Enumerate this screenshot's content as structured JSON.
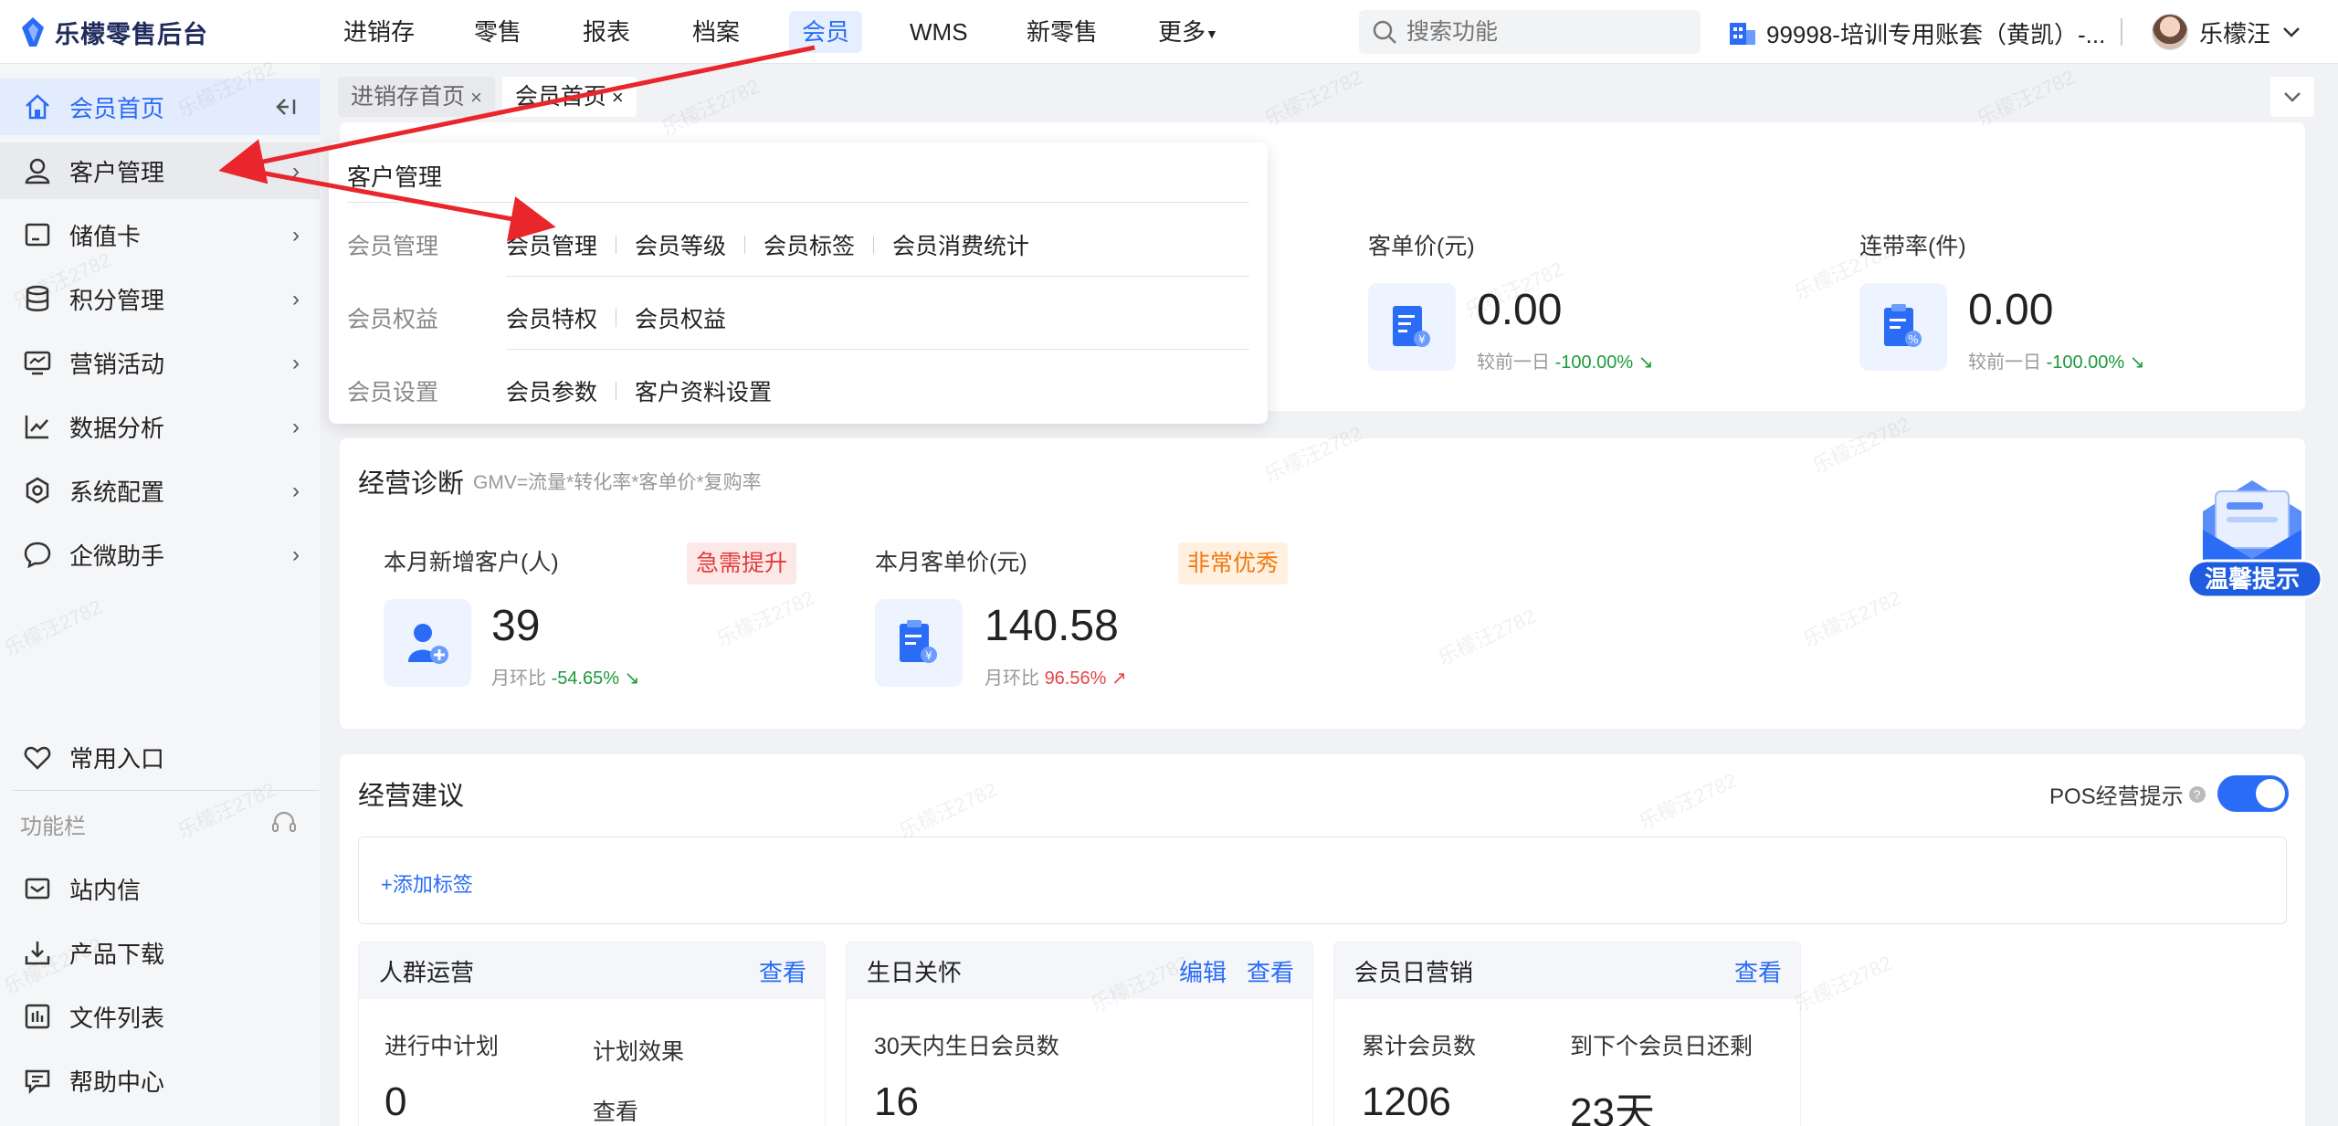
{
  "brand": {
    "name": "乐檬零售后台"
  },
  "nav": {
    "items": [
      {
        "label": "进销存"
      },
      {
        "label": "零售"
      },
      {
        "label": "报表"
      },
      {
        "label": "档案"
      },
      {
        "label": "会员",
        "active": true
      },
      {
        "label": "WMS"
      },
      {
        "label": "新零售"
      },
      {
        "label": "更多"
      }
    ],
    "search_placeholder": "搜索功能",
    "account": "99998-培训专用账套（黄凯）-...",
    "user": "乐檬汪"
  },
  "sidebar": {
    "items": [
      {
        "label": "会员首页",
        "icon": "home-icon",
        "active": true
      },
      {
        "label": "客户管理",
        "icon": "user-icon"
      },
      {
        "label": "储值卡",
        "icon": "card-icon"
      },
      {
        "label": "积分管理",
        "icon": "database-icon"
      },
      {
        "label": "营销活动",
        "icon": "monitor-icon"
      },
      {
        "label": "数据分析",
        "icon": "chart-icon"
      },
      {
        "label": "系统配置",
        "icon": "settings-icon"
      },
      {
        "label": "企微助手",
        "icon": "chat-icon"
      }
    ],
    "favorites": "常用入口",
    "toolbar_label": "功能栏",
    "tools": [
      {
        "label": "站内信",
        "icon": "mail-icon"
      },
      {
        "label": "产品下载",
        "icon": "download-icon"
      },
      {
        "label": "文件列表",
        "icon": "file-list-icon"
      },
      {
        "label": "帮助中心",
        "icon": "help-icon"
      }
    ]
  },
  "tabs": [
    {
      "label": "进销存首页"
    },
    {
      "label": "会员首页",
      "active": true
    }
  ],
  "metrics": [
    {
      "title": "客单价(元)",
      "value": "0.00",
      "cmp_label": "较前一日",
      "cmp_value": "-100.00%"
    },
    {
      "title": "连带率(件)",
      "value": "0.00",
      "cmp_label": "较前一日",
      "cmp_value": "-100.00%"
    }
  ],
  "diagnosis": {
    "title": "经营诊断",
    "formula": "GMV=流量*转化率*客单价*复购率",
    "items": [
      {
        "title": "本月新增客户(人)",
        "tag": "急需提升",
        "value": "39",
        "cmp_label": "月环比",
        "cmp_value": "-54.65%"
      },
      {
        "title": "本月客单价(元)",
        "tag": "非常优秀",
        "value": "140.58",
        "cmp_label": "月环比",
        "cmp_value": "96.56%"
      }
    ]
  },
  "advice": {
    "title": "经营建议",
    "pos_label": "POS经营提示",
    "pos_enabled": true,
    "add_tag": "+添加标签",
    "cards": [
      {
        "title": "人群运营",
        "actions": [
          "查看"
        ],
        "labels": [
          "进行中计划",
          "计划效果"
        ],
        "values": [
          "0",
          "查看"
        ]
      },
      {
        "title": "生日关怀",
        "actions": [
          "编辑",
          "查看"
        ],
        "labels": [
          "30天内生日会员数"
        ],
        "values": [
          "16"
        ]
      },
      {
        "title": "会员日营销",
        "actions": [
          "查看"
        ],
        "labels": [
          "累计会员数",
          "到下个会员日还剩"
        ],
        "values": [
          "1206",
          "23天"
        ]
      }
    ]
  },
  "dropdown": {
    "title": "客户管理",
    "groups": [
      {
        "name": "会员管理",
        "links": [
          "会员管理",
          "会员等级",
          "会员标签",
          "会员消费统计"
        ]
      },
      {
        "name": "会员权益",
        "links": [
          "会员特权",
          "会员权益"
        ]
      },
      {
        "name": "会员设置",
        "links": [
          "会员参数",
          "客户资料设置"
        ]
      }
    ]
  },
  "float_tip": {
    "label": "温馨提示"
  },
  "watermark": "乐檬汪2782",
  "colors": {
    "accent": "#2a6cf6",
    "arrow": "#e8262b",
    "up": "#e54545",
    "down": "#1a9a3a"
  }
}
